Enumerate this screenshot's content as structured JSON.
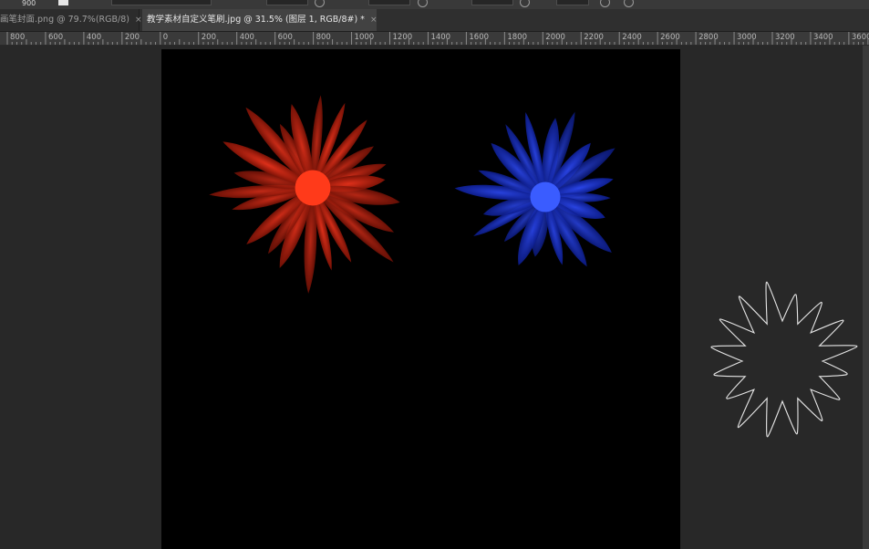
{
  "options_bar": {
    "brush_size": "900"
  },
  "tabs": [
    {
      "label": "画笔封面.png @ 79.7%(RGB/8)",
      "close": "×"
    },
    {
      "label": "教学素材自定义笔刷.jpg @ 31.5% (图层 1, RGB/8#) *",
      "close": "×"
    }
  ],
  "ruler": {
    "labels": [
      "800",
      "600",
      "400",
      "200",
      "0",
      "200",
      "400",
      "600",
      "800",
      "1000",
      "1200",
      "1400",
      "1600",
      "1800",
      "2000",
      "2200",
      "2400",
      "2600",
      "2800",
      "3000",
      "3200",
      "3400",
      "3600"
    ]
  },
  "canvas": {
    "background": "#000000"
  },
  "flowers": [
    {
      "name": "red-flower",
      "color": "#c8210f",
      "center_color": "#ff3a1a"
    },
    {
      "name": "blue-flower",
      "color": "#1a33d6",
      "center_color": "#3a5cff"
    }
  ],
  "cursor": {
    "icon": "brush-tip-outline-cursor",
    "color": "#e6e6e6"
  }
}
